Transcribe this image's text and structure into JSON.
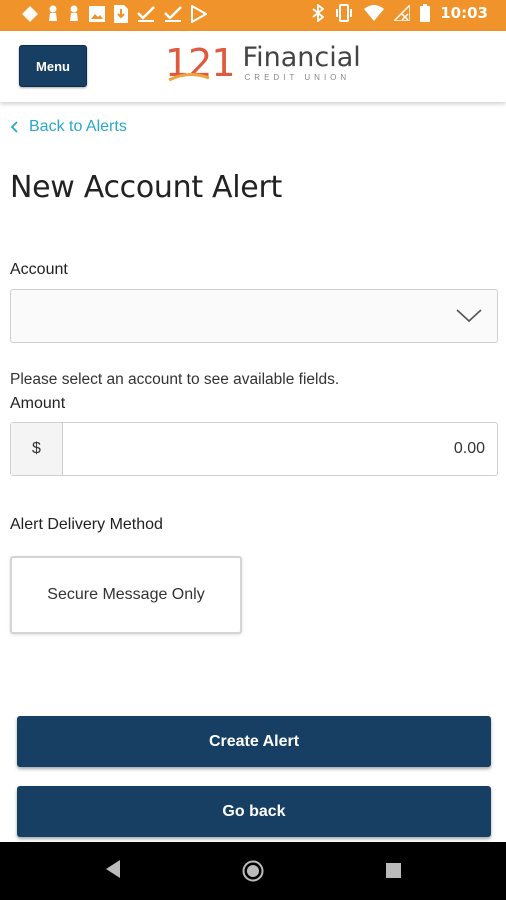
{
  "status_bar": {
    "time": "10:03",
    "left_icons": [
      "pinwheel-icon",
      "pawn-icon",
      "pawn-icon",
      "image-icon",
      "sim-download-icon",
      "check-icon",
      "check-icon",
      "play-store-icon"
    ],
    "right_icons": [
      "bluetooth-icon",
      "vibrate-icon",
      "wifi-icon",
      "no-signal-icon",
      "battery-icon"
    ],
    "color": "#f0932b"
  },
  "header": {
    "menu_label": "Menu",
    "logo_number": "121",
    "logo_name": "Financial",
    "logo_subtitle": "CREDIT UNION",
    "brand_color": "#163f63",
    "logo_accent": "#e05a3f"
  },
  "back_link": {
    "label": "Back to Alerts",
    "color": "#2aa7c9"
  },
  "page": {
    "title": "New Account Alert",
    "account_label": "Account",
    "account_value": "",
    "help_text": "Please select an account to see available fields.",
    "amount_label": "Amount",
    "amount_prefix": "$",
    "amount_value": "0.00",
    "delivery_label": "Alert Delivery Method",
    "delivery_option": "Secure Message Only"
  },
  "actions": {
    "create_label": "Create Alert",
    "back_label": "Go back"
  },
  "nav_bar": {
    "items": [
      "back-icon",
      "home-icon",
      "recents-icon"
    ]
  }
}
